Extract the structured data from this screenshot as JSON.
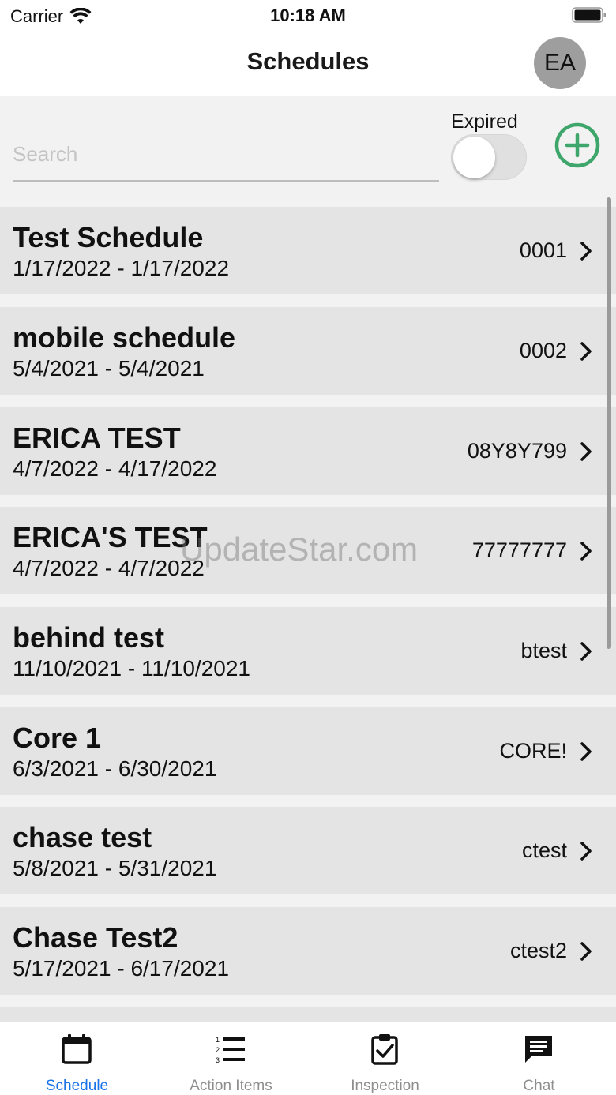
{
  "status_bar": {
    "carrier": "Carrier",
    "time": "10:18 AM"
  },
  "nav": {
    "title": "Schedules",
    "avatar_initials": "EA"
  },
  "filter": {
    "search_placeholder": "Search",
    "search_value": "",
    "expired_label": "Expired",
    "expired_on": false
  },
  "colors": {
    "accent_green": "#3ea66b",
    "active_tab": "#1a73e8",
    "row_bg": "#e4e4e4"
  },
  "schedules": [
    {
      "title": "Test Schedule",
      "dates": "1/17/2022 - 1/17/2022",
      "code": "0001"
    },
    {
      "title": "mobile schedule",
      "dates": "5/4/2021 - 5/4/2021",
      "code": "0002"
    },
    {
      "title": "ERICA TEST",
      "dates": "4/7/2022 - 4/17/2022",
      "code": "08Y8Y799"
    },
    {
      "title": "ERICA'S TEST",
      "dates": "4/7/2022 - 4/7/2022",
      "code": "77777777"
    },
    {
      "title": "behind test",
      "dates": "11/10/2021 - 11/10/2021",
      "code": "btest"
    },
    {
      "title": "Core 1",
      "dates": "6/3/2021 - 6/30/2021",
      "code": "CORE!"
    },
    {
      "title": "chase test",
      "dates": "5/8/2021 - 5/31/2021",
      "code": "ctest"
    },
    {
      "title": "Chase Test2",
      "dates": "5/17/2021 - 6/17/2021",
      "code": "ctest2"
    }
  ],
  "watermark": "UpdateStar.com",
  "tabs": [
    {
      "label": "Schedule",
      "icon": "calendar-icon",
      "active": true
    },
    {
      "label": "Action Items",
      "icon": "list-numbered-icon",
      "active": false
    },
    {
      "label": "Inspection",
      "icon": "clipboard-check-icon",
      "active": false
    },
    {
      "label": "Chat",
      "icon": "chat-icon",
      "active": false
    }
  ]
}
